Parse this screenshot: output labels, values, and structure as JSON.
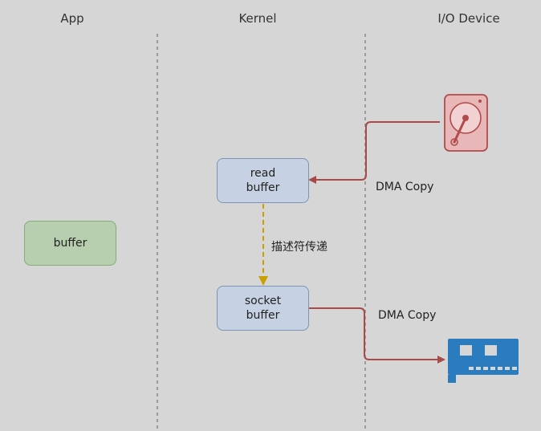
{
  "columns": {
    "app": "App",
    "kernel": "Kernel",
    "device": "I/O Device"
  },
  "boxes": {
    "read_buffer": [
      "read",
      "buffer"
    ],
    "socket_buffer": [
      "socket",
      "buffer"
    ],
    "app_buffer": "buffer"
  },
  "edges": {
    "dma_read": "DMA Copy",
    "descriptor": "描述符传递",
    "dma_write": "DMA Copy"
  },
  "icons": {
    "disk": "hard-disk-icon",
    "nic": "network-card-icon"
  },
  "colors": {
    "background": "#d6d6d6",
    "kernel_box": "#c6d2e3",
    "app_box": "#b7cfaf",
    "dma_arrow": "#a84a4a",
    "descriptor_arrow": "#c9a000",
    "disk": "#e8b7b7",
    "nic": "#2a7cbf"
  }
}
